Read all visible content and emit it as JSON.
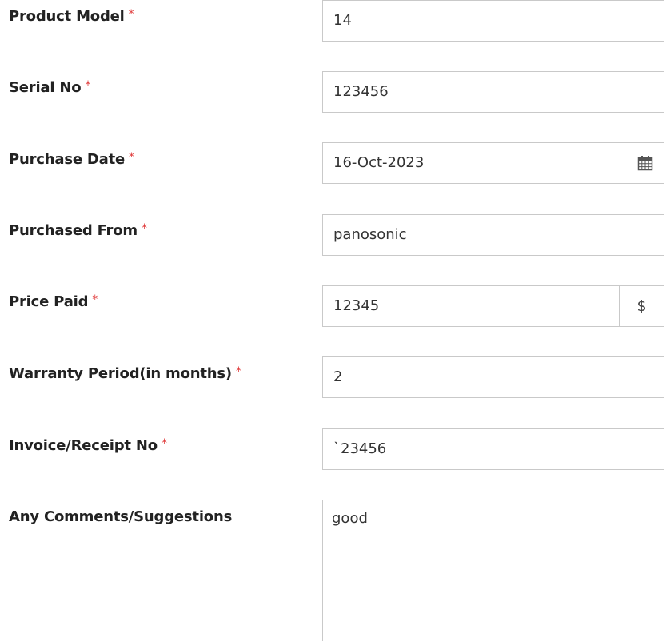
{
  "form": {
    "product_model": {
      "label": "Product Model",
      "required_mark": "*",
      "value": "14"
    },
    "serial_no": {
      "label": "Serial No",
      "required_mark": "*",
      "value": "123456"
    },
    "purchase_date": {
      "label": "Purchase Date",
      "required_mark": "*",
      "value": "16-Oct-2023",
      "icon": "calendar-icon"
    },
    "purchased_from": {
      "label": "Purchased From",
      "required_mark": "*",
      "value": "panosonic"
    },
    "price_paid": {
      "label": "Price Paid",
      "required_mark": "*",
      "value": "12345",
      "addon": "$"
    },
    "warranty_period": {
      "label": "Warranty Period(in months)",
      "required_mark": "*",
      "value": "2"
    },
    "invoice_no": {
      "label": "Invoice/Receipt No",
      "required_mark": "*",
      "value": "`23456"
    },
    "comments": {
      "label": "Any Comments/Suggestions",
      "value": "good"
    }
  },
  "colors": {
    "required": "#e03a3a",
    "border": "#c9c9c9",
    "label": "#222222",
    "value": "#333333"
  }
}
